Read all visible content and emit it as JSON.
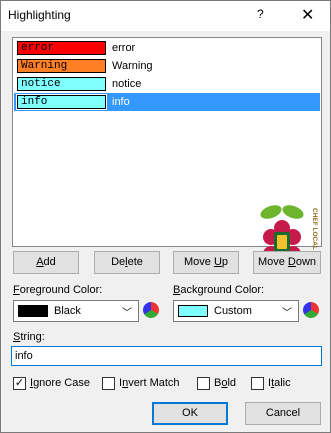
{
  "window": {
    "title": "Highlighting",
    "help_glyph": "?",
    "close_glyph": "✕"
  },
  "list": {
    "items": [
      {
        "swatch_text": "error",
        "swatch_fg": "#000000",
        "swatch_bg": "#ff0000",
        "desc": "error",
        "selected": false
      },
      {
        "swatch_text": "Warning",
        "swatch_fg": "#000000",
        "swatch_bg": "#ff7f27",
        "desc": "Warning",
        "selected": false
      },
      {
        "swatch_text": "notice",
        "swatch_fg": "#000000",
        "swatch_bg": "#80ffff",
        "desc": "notice",
        "selected": false
      },
      {
        "swatch_text": "info",
        "swatch_fg": "#000000",
        "swatch_bg": "#80ffff",
        "desc": "info",
        "selected": true
      }
    ],
    "logo_text": "CHEF LOCAL"
  },
  "buttons": {
    "add": "Add",
    "delete": "Delete",
    "move_up": "Move Up",
    "move_down": "Move Down",
    "ok": "OK",
    "cancel": "Cancel"
  },
  "foreground": {
    "label": "Foreground Color:",
    "value": "Black",
    "color": "#000000"
  },
  "background": {
    "label": "Background Color:",
    "value": "Custom",
    "color": "#80ffff"
  },
  "string": {
    "label": "String:",
    "value": "info"
  },
  "options": {
    "ignore_case": {
      "label": "Ignore Case",
      "checked": true
    },
    "invert_match": {
      "label": "Invert Match",
      "checked": false
    },
    "bold": {
      "label": "Bold",
      "checked": false
    },
    "italic": {
      "label": "Italic",
      "checked": false
    }
  },
  "colors": {
    "selection": "#3399ff",
    "accent": "#0078d7"
  }
}
